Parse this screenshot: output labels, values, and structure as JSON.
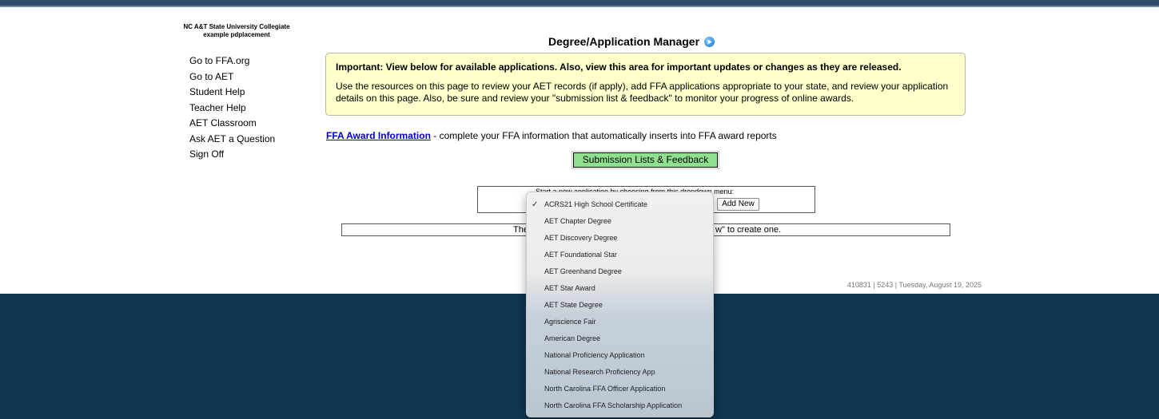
{
  "school": {
    "name": "NC A&T State University Collegiate",
    "account": "example pdplacement"
  },
  "nav": [
    "Go to FFA.org",
    "Go to AET",
    "Student Help",
    "Teacher Help",
    "AET Classroom",
    "Ask AET a Question",
    "Sign Off"
  ],
  "page": {
    "title": "Degree/Application Manager"
  },
  "notice": {
    "heading": "Important: View below for available applications. Also, view this area for important updates or changes as they are released.",
    "body": "Use the resources on this page to review your AET records (if apply), add FFA applications appropriate to your state, and review your application details on this page. Also, be sure and review your \"submission list & feedback\" to monitor your progress of online awards."
  },
  "ffa": {
    "link": "FFA Award Information",
    "text": " - complete your FFA information that automatically inserts into FFA award reports"
  },
  "submission_button": "Submission Lists & Feedback",
  "new_app": {
    "label": "Start a new application by choosing from this dropdown menu:",
    "add_button": "Add New"
  },
  "none_message_left": "The",
  "none_message_right": "w\" to create one.",
  "footer_info": "410831 | 5243 | Tuesday, August 19, 2025",
  "dropdown": {
    "selected": "ACRS21 High School Certificate",
    "options": [
      "ACRS21 High School Certificate",
      "AET Chapter Degree",
      "AET Discovery Degree",
      "AET Foundational Star",
      "AET Greenhand Degree",
      "AET Star Award",
      "AET State Degree",
      "Agriscience Fair",
      "American Degree",
      "National Proficiency Application",
      "National Research Proficiency App",
      "North Carolina FFA Officer Application",
      "North Carolina FFA Scholarship Application"
    ]
  },
  "colors": {
    "topbar": "#2e4e6a",
    "footer": "#0f3550",
    "notice_bg": "#ffffcc",
    "button_green": "#8fe08f",
    "link": "#0000cc"
  }
}
